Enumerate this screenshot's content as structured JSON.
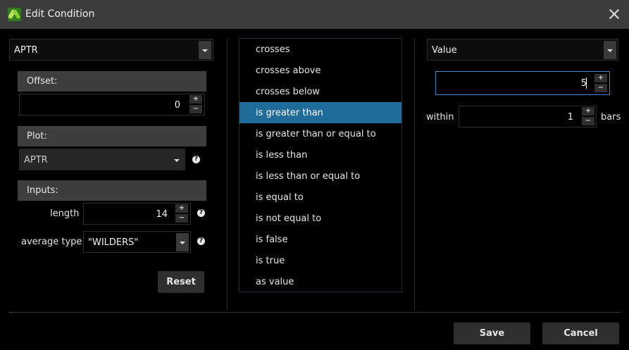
{
  "window": {
    "title": "Edit Condition",
    "icon": "app-leaf-icon",
    "close_icon": "close-icon"
  },
  "left": {
    "study_select": "APTR",
    "offset": {
      "header": "Offset:",
      "value": "0"
    },
    "plot": {
      "header": "Plot:",
      "value": "APTR"
    },
    "inputs": {
      "header": "Inputs:",
      "length_label": "length",
      "length_value": "14",
      "avg_type_label": "average type",
      "avg_type_value": "\"WILDERS\""
    },
    "help_glyph": "?",
    "reset_label": "Reset"
  },
  "operators": {
    "selected_index": 3,
    "items": [
      "crosses",
      "crosses above",
      "crosses below",
      "is greater than",
      "is greater than or equal to",
      "is less than",
      "is less than or equal to",
      "is equal to",
      "is not equal to",
      "is false",
      "is true",
      "as value"
    ]
  },
  "right": {
    "type_select": "Value",
    "value": "5",
    "within_label": "within",
    "within_value": "1",
    "bars_label": "bars"
  },
  "spin": {
    "up": "+",
    "down": "−"
  },
  "footer": {
    "save_label": "Save",
    "cancel_label": "Cancel"
  },
  "colors": {
    "selected": "#1f6c9a",
    "header_bg": "#3e3e3e",
    "button_bg": "#2e2e2e"
  }
}
